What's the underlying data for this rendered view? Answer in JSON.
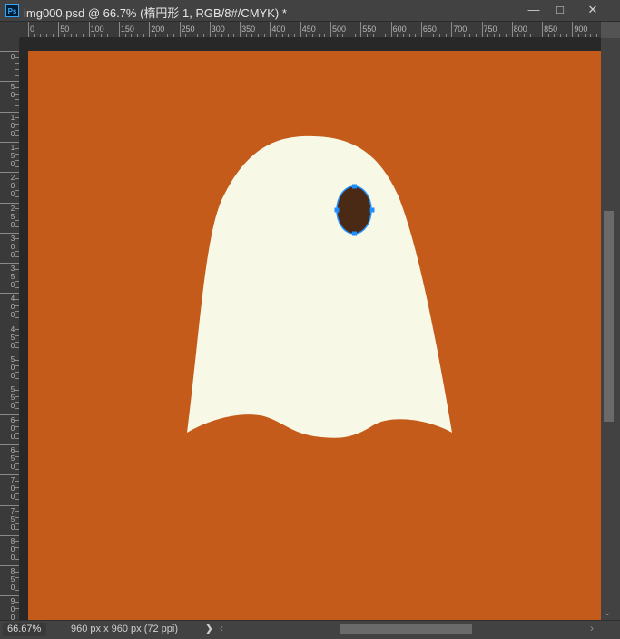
{
  "window": {
    "title": "img000.psd @ 66.7% (楕円形 1, RGB/8#/CMYK) *",
    "app_icon": "Ps",
    "minimize_icon": "minimize-icon",
    "maximize_icon": "maximize-icon",
    "close_icon": "close-icon"
  },
  "ruler": {
    "horizontal_labels": [
      "0",
      "50",
      "100",
      "150",
      "200",
      "250",
      "300",
      "350",
      "400",
      "450",
      "500",
      "550",
      "600",
      "650",
      "700",
      "750",
      "800",
      "850",
      "900"
    ],
    "vertical_labels": [
      "0",
      "50",
      "100",
      "150",
      "200",
      "250",
      "300",
      "350",
      "400",
      "450",
      "500",
      "550",
      "600",
      "650",
      "700",
      "750",
      "800",
      "850",
      "900"
    ]
  },
  "canvas": {
    "background": "#C45B1B",
    "ghost_color": "#F8F8E6",
    "eye_color": "#4A2A14",
    "selection_color": "#1E8FFF"
  },
  "status": {
    "zoom": "66.67%",
    "doc_info": "960 px x 960 px (72 ppi)",
    "arrow": "❯"
  }
}
